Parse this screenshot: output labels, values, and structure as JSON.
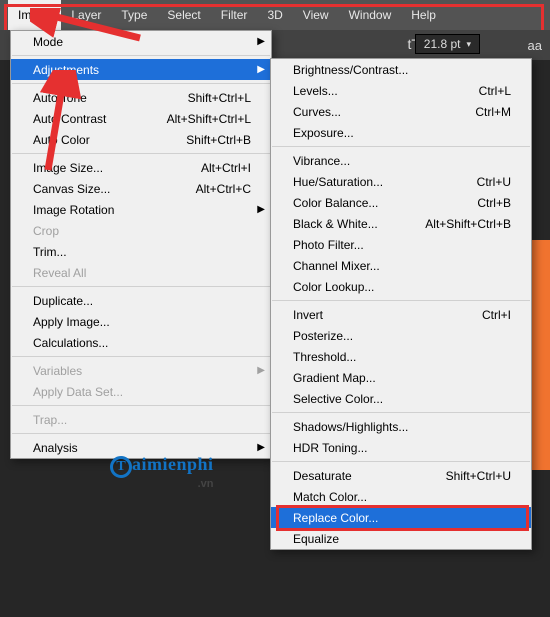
{
  "topbar": {
    "items": [
      "Image",
      "Layer",
      "Type",
      "Select",
      "Filter",
      "3D",
      "View",
      "Window",
      "Help"
    ],
    "active_index": 0
  },
  "toolbar": {
    "font_size": "21.8 pt",
    "aa": "aa"
  },
  "menu1": {
    "mode": "Mode",
    "adjustments": "Adjustments",
    "auto_tone": {
      "label": "Auto Tone",
      "shortcut": "Shift+Ctrl+L"
    },
    "auto_contrast": {
      "label": "Auto Contrast",
      "shortcut": "Alt+Shift+Ctrl+L"
    },
    "auto_color": {
      "label": "Auto Color",
      "shortcut": "Shift+Ctrl+B"
    },
    "image_size": {
      "label": "Image Size...",
      "shortcut": "Alt+Ctrl+I"
    },
    "canvas_size": {
      "label": "Canvas Size...",
      "shortcut": "Alt+Ctrl+C"
    },
    "image_rotation": "Image Rotation",
    "crop": "Crop",
    "trim": "Trim...",
    "reveal_all": "Reveal All",
    "duplicate": "Duplicate...",
    "apply_image": "Apply Image...",
    "calculations": "Calculations...",
    "variables": "Variables",
    "apply_data_set": "Apply Data Set...",
    "trap": "Trap...",
    "analysis": "Analysis"
  },
  "menu2": {
    "brightness": "Brightness/Contrast...",
    "levels": {
      "label": "Levels...",
      "shortcut": "Ctrl+L"
    },
    "curves": {
      "label": "Curves...",
      "shortcut": "Ctrl+M"
    },
    "exposure": "Exposure...",
    "vibrance": "Vibrance...",
    "hue": {
      "label": "Hue/Saturation...",
      "shortcut": "Ctrl+U"
    },
    "color_balance": {
      "label": "Color Balance...",
      "shortcut": "Ctrl+B"
    },
    "bw": {
      "label": "Black & White...",
      "shortcut": "Alt+Shift+Ctrl+B"
    },
    "photo_filter": "Photo Filter...",
    "channel_mixer": "Channel Mixer...",
    "color_lookup": "Color Lookup...",
    "invert": {
      "label": "Invert",
      "shortcut": "Ctrl+I"
    },
    "posterize": "Posterize...",
    "threshold": "Threshold...",
    "gradient_map": "Gradient Map...",
    "selective_color": "Selective Color...",
    "shadows": "Shadows/Highlights...",
    "hdr": "HDR Toning...",
    "desaturate": {
      "label": "Desaturate",
      "shortcut": "Shift+Ctrl+U"
    },
    "match_color": "Match Color...",
    "replace_color": "Replace Color...",
    "equalize": "Equalize"
  },
  "watermark": {
    "t": "T",
    "text": "aimienphi",
    "vn": ".vn"
  }
}
